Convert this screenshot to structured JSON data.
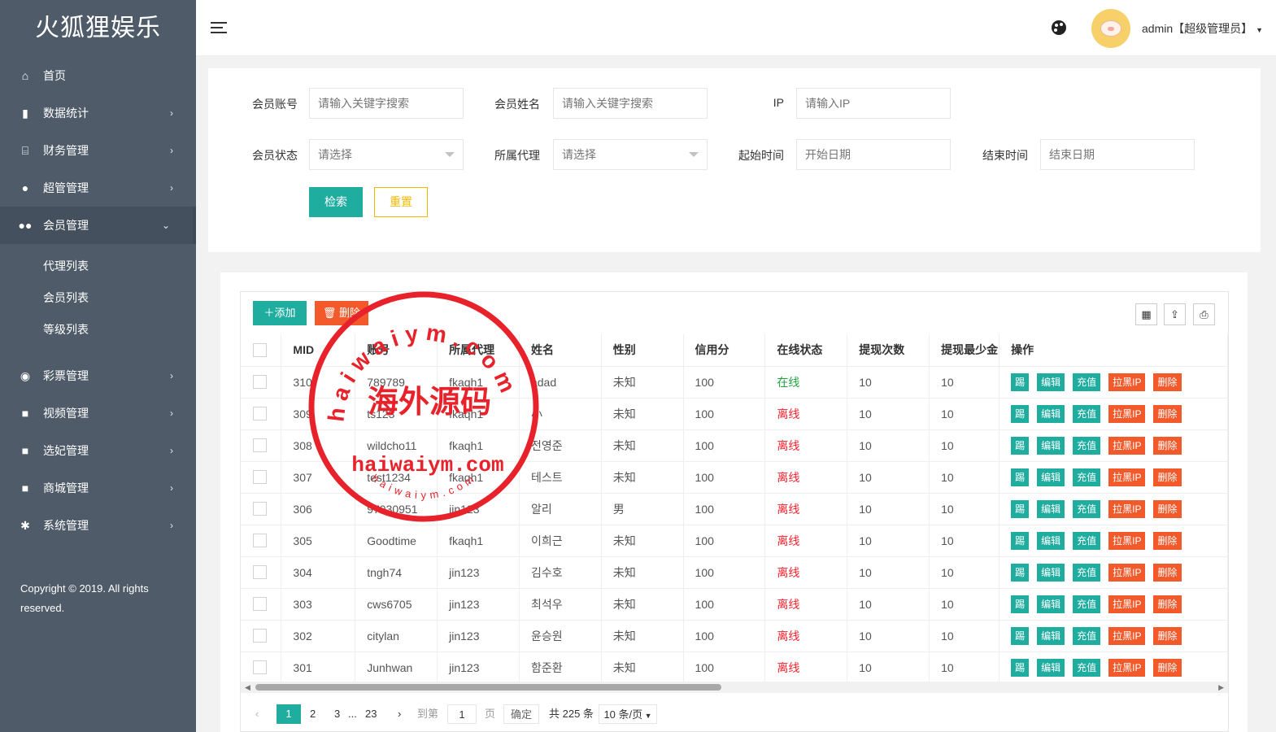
{
  "app": {
    "title": "火狐狸娱乐",
    "copyright": "Copyright © 2019. All rights reserved."
  },
  "nav": {
    "items": [
      {
        "label": "首页",
        "icon": "home-icon",
        "glyph": "⌂",
        "arrow": ""
      },
      {
        "label": "数据统计",
        "icon": "bar-chart-icon",
        "glyph": "▮",
        "arrow": "›"
      },
      {
        "label": "财务管理",
        "icon": "bank-icon",
        "glyph": "⌸",
        "arrow": "›"
      },
      {
        "label": "超管管理",
        "icon": "user-icon",
        "glyph": "●",
        "arrow": "›"
      },
      {
        "label": "会员管理",
        "icon": "users-icon",
        "glyph": "●●",
        "arrow": "⌄"
      }
    ],
    "sub_items": [
      {
        "label": "代理列表"
      },
      {
        "label": "会员列表"
      },
      {
        "label": "等级列表"
      }
    ],
    "items2": [
      {
        "label": "彩票管理",
        "icon": "gamepad-icon",
        "glyph": "◉",
        "arrow": "›"
      },
      {
        "label": "视频管理",
        "icon": "video-icon",
        "glyph": "■",
        "arrow": "›"
      },
      {
        "label": "选妃管理",
        "icon": "video-icon",
        "glyph": "■",
        "arrow": "›"
      },
      {
        "label": "商城管理",
        "icon": "video-icon",
        "glyph": "■",
        "arrow": "›"
      },
      {
        "label": "系统管理",
        "icon": "gear-icon",
        "glyph": "✱",
        "arrow": "›"
      }
    ]
  },
  "header": {
    "user": "admin【超级管理员】"
  },
  "search": {
    "account_label": "会员账号",
    "account_placeholder": "请输入关键字搜索",
    "name_label": "会员姓名",
    "name_placeholder": "请输入关键字搜索",
    "ip_label": "IP",
    "ip_placeholder": "请输入IP",
    "status_label": "会员状态",
    "status_value": "请选择",
    "agent_label": "所属代理",
    "agent_value": "请选择",
    "start_label": "起始时间",
    "start_placeholder": "开始日期",
    "end_label": "结束时间",
    "end_placeholder": "结束日期",
    "search_button": "检索",
    "reset_button": "重置"
  },
  "toolbar": {
    "add": "添加",
    "delete": "删除"
  },
  "table": {
    "columns": [
      "MID",
      "账号",
      "所属代理",
      "姓名",
      "性别",
      "信用分",
      "在线状态",
      "提现次数",
      "提现最少金",
      "操作"
    ],
    "actions": [
      "踢",
      "编辑",
      "充值",
      "拉黑IP",
      "删除"
    ],
    "rows": [
      {
        "mid": "310",
        "account": "789789",
        "agent": "fkaqh1",
        "name": "adad",
        "gender": "未知",
        "credit": "100",
        "status": "在线",
        "online": true,
        "wcount": "10",
        "wmin": "10"
      },
      {
        "mid": "309",
        "account": "ts123",
        "agent": "fkaqh1",
        "name": "小",
        "gender": "未知",
        "credit": "100",
        "status": "离线",
        "online": false,
        "wcount": "10",
        "wmin": "10"
      },
      {
        "mid": "308",
        "account": "wildcho11",
        "agent": "fkaqh1",
        "name": "전영준",
        "gender": "未知",
        "credit": "100",
        "status": "离线",
        "online": false,
        "wcount": "10",
        "wmin": "10"
      },
      {
        "mid": "307",
        "account": "test1234",
        "agent": "fkaqh1",
        "name": "테스트",
        "gender": "未知",
        "credit": "100",
        "status": "离线",
        "online": false,
        "wcount": "10",
        "wmin": "10"
      },
      {
        "mid": "306",
        "account": "97030951",
        "agent": "jin123",
        "name": "알리",
        "gender": "男",
        "credit": "100",
        "status": "离线",
        "online": false,
        "wcount": "10",
        "wmin": "10"
      },
      {
        "mid": "305",
        "account": "Goodtime",
        "agent": "fkaqh1",
        "name": "이희근",
        "gender": "未知",
        "credit": "100",
        "status": "离线",
        "online": false,
        "wcount": "10",
        "wmin": "10"
      },
      {
        "mid": "304",
        "account": "tngh74",
        "agent": "jin123",
        "name": "김수호",
        "gender": "未知",
        "credit": "100",
        "status": "离线",
        "online": false,
        "wcount": "10",
        "wmin": "10"
      },
      {
        "mid": "303",
        "account": "cws6705",
        "agent": "jin123",
        "name": "최석우",
        "gender": "未知",
        "credit": "100",
        "status": "离线",
        "online": false,
        "wcount": "10",
        "wmin": "10"
      },
      {
        "mid": "302",
        "account": "citylan",
        "agent": "jin123",
        "name": "윤승원",
        "gender": "未知",
        "credit": "100",
        "status": "离线",
        "online": false,
        "wcount": "10",
        "wmin": "10"
      },
      {
        "mid": "301",
        "account": "Junhwan",
        "agent": "jin123",
        "name": "함준환",
        "gender": "未知",
        "credit": "100",
        "status": "离线",
        "online": false,
        "wcount": "10",
        "wmin": "10"
      }
    ]
  },
  "pager": {
    "pages": [
      "1",
      "2",
      "3",
      "...",
      "23"
    ],
    "goto_label": "到第",
    "goto_value": "1",
    "page_unit": "页",
    "confirm": "确定",
    "total": "共 225 条",
    "page_size": "10 条/页"
  },
  "watermark": {
    "top_text": "haiwaiym.com",
    "left_text": "www.",
    "center_cn": "海外源码",
    "center_en": "haiwaiym.com",
    "bottom_text": "haiwaiym.com"
  },
  "colors": {
    "sidebar": "#4f5b69",
    "teal": "#1fada0",
    "red": "#f25a2c",
    "online": "#1fa33f",
    "offline": "#f5222d",
    "stamp": "#e8222a"
  }
}
